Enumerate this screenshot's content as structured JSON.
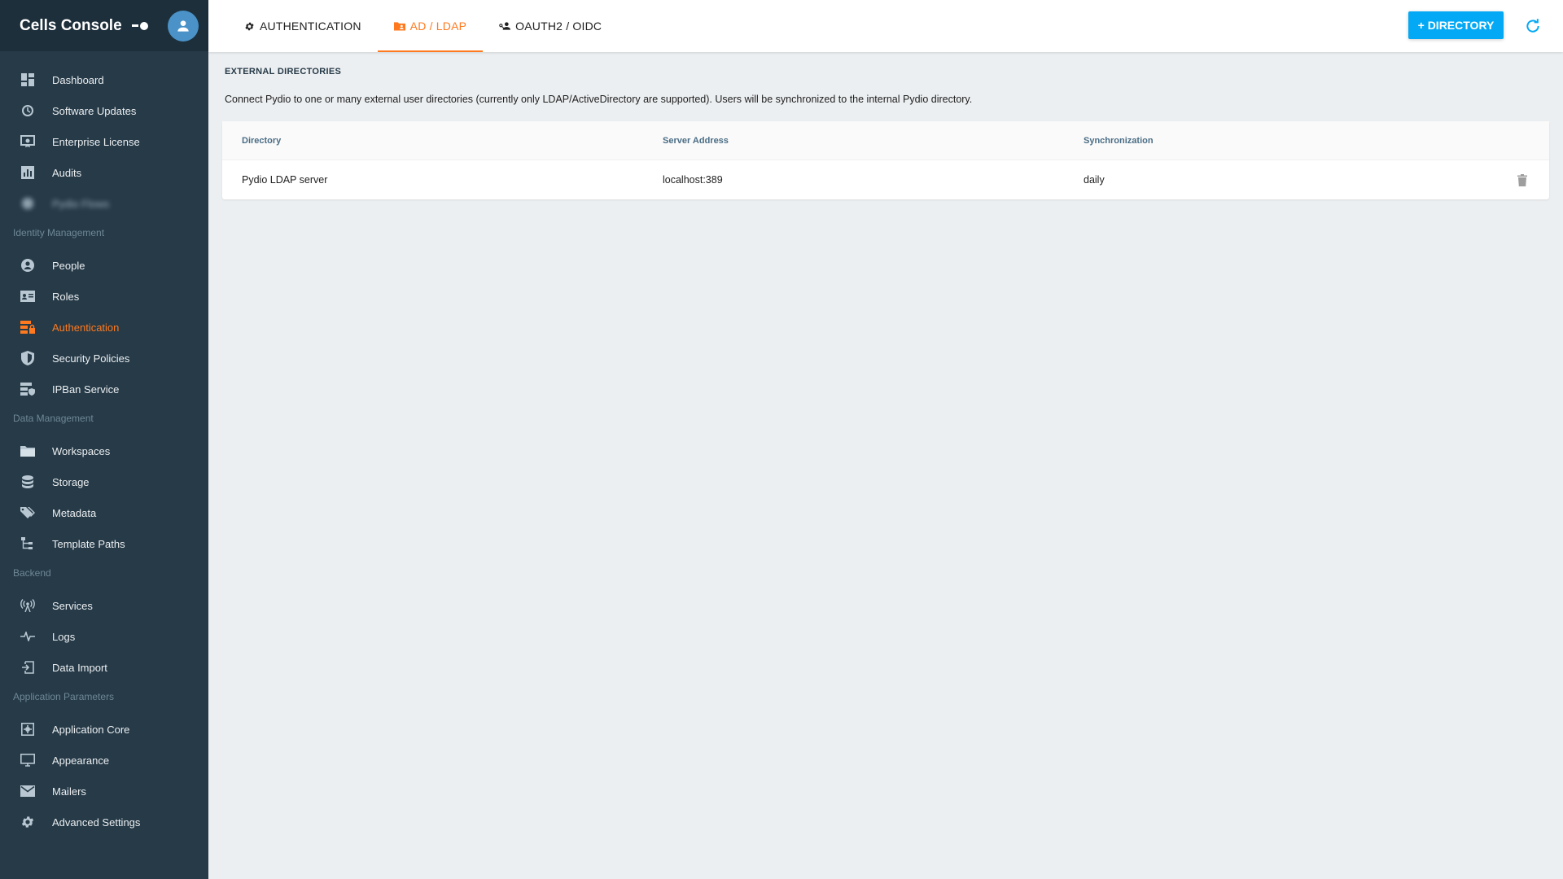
{
  "app": {
    "title": "Cells Console"
  },
  "sidebar": {
    "items_top": [
      {
        "label": "Dashboard",
        "icon": "dashboard-icon"
      },
      {
        "label": "Software Updates",
        "icon": "update-icon"
      },
      {
        "label": "Enterprise License",
        "icon": "license-icon"
      },
      {
        "label": "Audits",
        "icon": "chart-icon"
      },
      {
        "label": "Pydio Flows",
        "icon": "blurred-icon"
      }
    ],
    "sections": [
      {
        "title": "Identity Management",
        "items": [
          {
            "label": "People",
            "icon": "person-icon"
          },
          {
            "label": "Roles",
            "icon": "id-card-icon"
          },
          {
            "label": "Authentication",
            "icon": "server-lock-icon",
            "active": true
          },
          {
            "label": "Security Policies",
            "icon": "shield-icon"
          },
          {
            "label": "IPBan Service",
            "icon": "server-shield-icon"
          }
        ]
      },
      {
        "title": "Data Management",
        "items": [
          {
            "label": "Workspaces",
            "icon": "folder-icon"
          },
          {
            "label": "Storage",
            "icon": "database-icon"
          },
          {
            "label": "Metadata",
            "icon": "tags-icon"
          },
          {
            "label": "Template Paths",
            "icon": "file-tree-icon"
          }
        ]
      },
      {
        "title": "Backend",
        "items": [
          {
            "label": "Services",
            "icon": "antenna-icon"
          },
          {
            "label": "Logs",
            "icon": "pulse-icon"
          },
          {
            "label": "Data Import",
            "icon": "import-icon"
          }
        ]
      },
      {
        "title": "Application Parameters",
        "items": [
          {
            "label": "Application Core",
            "icon": "core-icon"
          },
          {
            "label": "Appearance",
            "icon": "monitor-icon"
          },
          {
            "label": "Mailers",
            "icon": "mail-icon"
          },
          {
            "label": "Advanced Settings",
            "icon": "gear-icon"
          }
        ]
      }
    ]
  },
  "tabs": [
    {
      "label": "AUTHENTICATION",
      "icon": "cog-icon",
      "active": false
    },
    {
      "label": "AD / LDAP",
      "icon": "folder-account-icon",
      "active": true
    },
    {
      "label": "OAUTH2 / OIDC",
      "icon": "account-key-icon",
      "active": false
    }
  ],
  "toolbar": {
    "add_directory_label": "+ DIRECTORY",
    "refresh_icon": "refresh-icon"
  },
  "content": {
    "section_title": "EXTERNAL DIRECTORIES",
    "description": "Connect Pydio to one or many external user directories (currently only LDAP/ActiveDirectory are supported). Users will be synchronized to the internal Pydio directory.",
    "table": {
      "columns": [
        "Directory",
        "Server Address",
        "Synchronization"
      ],
      "rows": [
        {
          "directory": "Pydio LDAP server",
          "server": "localhost:389",
          "sync": "daily"
        }
      ]
    }
  },
  "colors": {
    "sidebar_bg": "#263a48",
    "accent": "#ff7a1f",
    "primary_button": "#03a9f4"
  }
}
